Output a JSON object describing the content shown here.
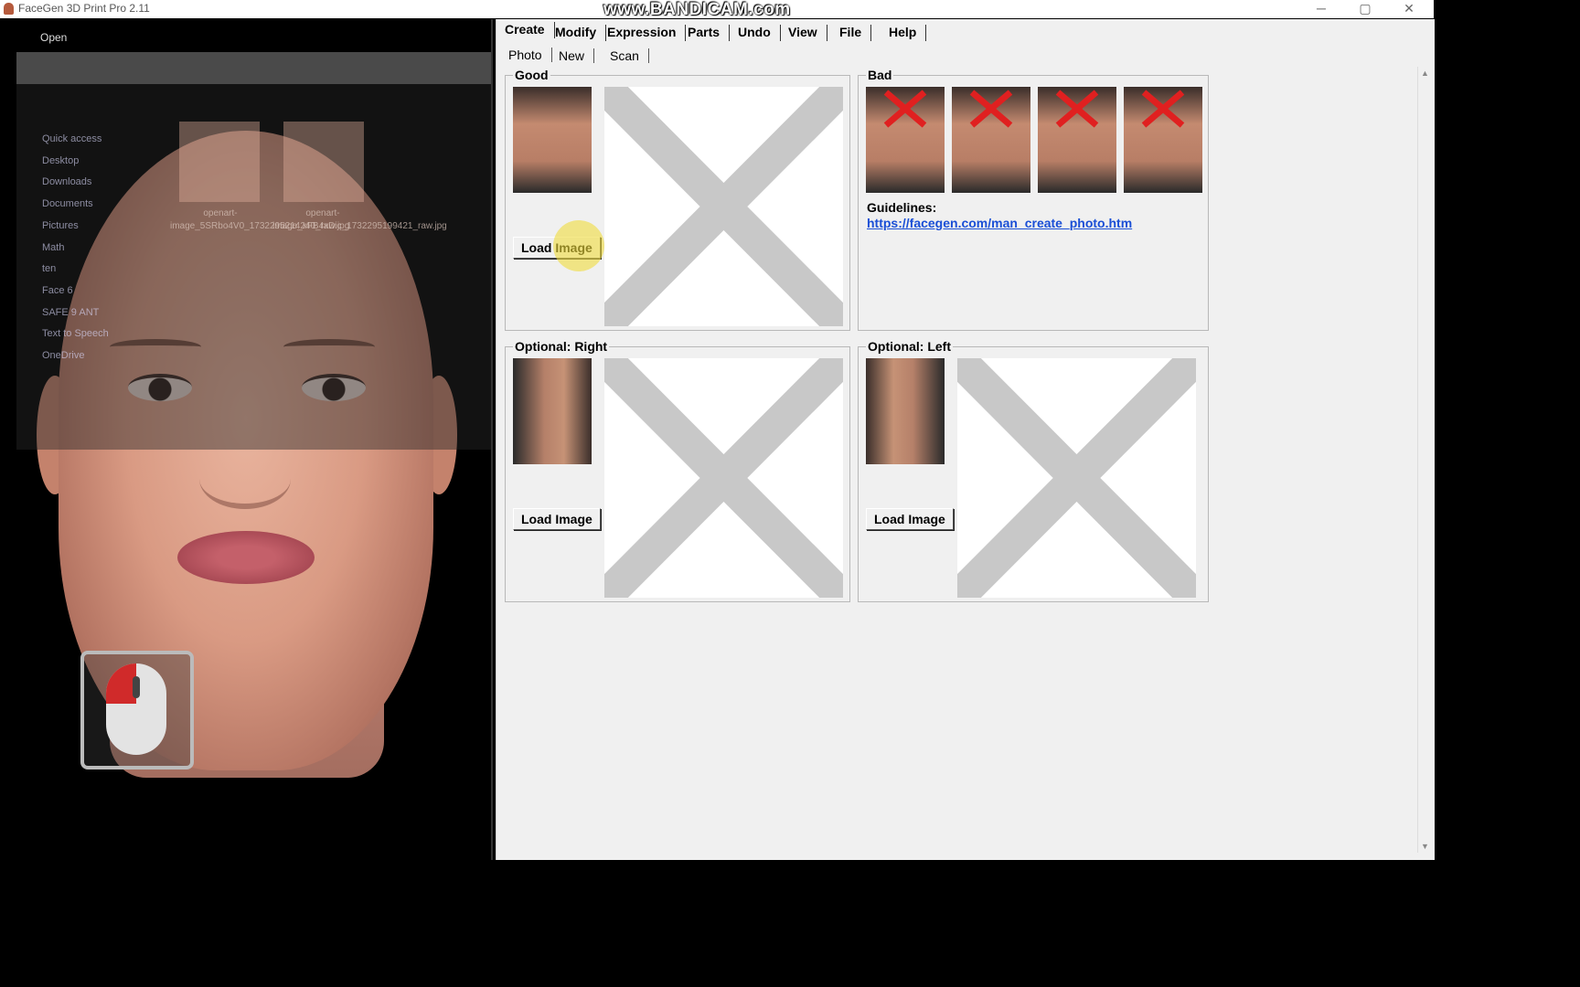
{
  "window": {
    "title": "FaceGen 3D Print Pro 2.11",
    "watermark": "www.BANDICAM.com",
    "minimize_glyph": "─",
    "maximize_glyph": "▢",
    "close_glyph": "✕"
  },
  "overlay_dialog": {
    "title": "Open",
    "sidebar_items": [
      "Quick access",
      "Desktop",
      "Downloads",
      "Documents",
      "Pictures",
      "Math",
      "ten",
      "Face 6",
      "SAFE 9 ANT",
      "Text to Speech",
      "OneDrive"
    ],
    "files": [
      {
        "name": "openart-image_5SRbo4V0_1732295214240_raw.jpg"
      },
      {
        "name": "openart-image_xFB4xDic_1732295199421_raw.jpg"
      }
    ]
  },
  "menu": {
    "items": [
      "Create",
      "Modify",
      "Expression",
      "Parts",
      "Undo",
      "View",
      "File",
      "Help"
    ],
    "active": "Create"
  },
  "submenu": {
    "items": [
      "Photo",
      "New",
      "Scan"
    ],
    "active": "Photo"
  },
  "groups": {
    "good": {
      "label": "Good",
      "button": "Load Image"
    },
    "bad": {
      "label": "Bad",
      "guidelines_label": "Guidelines:",
      "guidelines_link": "https://facegen.com/man_create_photo.htm"
    },
    "right": {
      "label": "Optional: Right",
      "button": "Load Image"
    },
    "left": {
      "label": "Optional: Left",
      "button": "Load Image"
    }
  },
  "colors": {
    "panel_bg": "#f0f0f0",
    "link": "#1a4fd6",
    "bad_mark": "#e02020",
    "placeholder_x": "#c8c8c8"
  }
}
